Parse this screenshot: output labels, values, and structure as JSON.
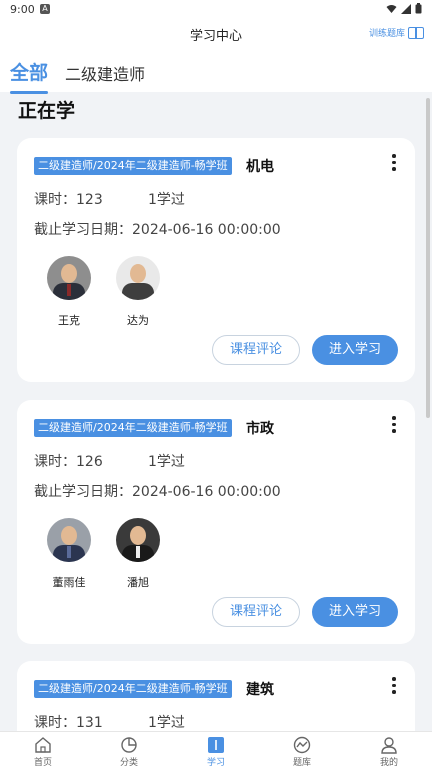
{
  "statusbar": {
    "time": "9:00",
    "app_badge": "A"
  },
  "header": {
    "title": "学习中心",
    "train_label": "训练题库"
  },
  "tabs": [
    {
      "label": "全部",
      "active": true
    },
    {
      "label": "二级建造师",
      "active": false
    }
  ],
  "section_title": "正在学",
  "labels": {
    "hours_prefix": "课时：",
    "deadline_prefix": "截止学习日期：",
    "review_button": "课程评论",
    "enter_button": "进入学习"
  },
  "courses": [
    {
      "badge": "二级建造师/2024年二级建造师-畅学班",
      "subject": "机电",
      "hours": "123",
      "studied": "1学过",
      "deadline": "2024-06-16 00:00:00",
      "teachers": [
        {
          "name": "王克"
        },
        {
          "name": "达为"
        }
      ]
    },
    {
      "badge": "二级建造师/2024年二级建造师-畅学班",
      "subject": "市政",
      "hours": "126",
      "studied": "1学过",
      "deadline": "2024-06-16 00:00:00",
      "teachers": [
        {
          "name": "董雨佳"
        },
        {
          "name": "潘旭"
        }
      ]
    },
    {
      "badge": "二级建造师/2024年二级建造师-畅学班",
      "subject": "建筑",
      "hours": "131",
      "studied": "1学过"
    }
  ],
  "bottom_nav": [
    {
      "label": "首页",
      "icon": "home-icon"
    },
    {
      "label": "分类",
      "icon": "pie-chart-icon"
    },
    {
      "label": "学习",
      "icon": "study-book-icon",
      "active": true
    },
    {
      "label": "题库",
      "icon": "trend-icon"
    },
    {
      "label": "我的",
      "icon": "user-icon"
    }
  ],
  "colors": {
    "accent": "#4a90e2",
    "background": "#f1f3f6"
  }
}
